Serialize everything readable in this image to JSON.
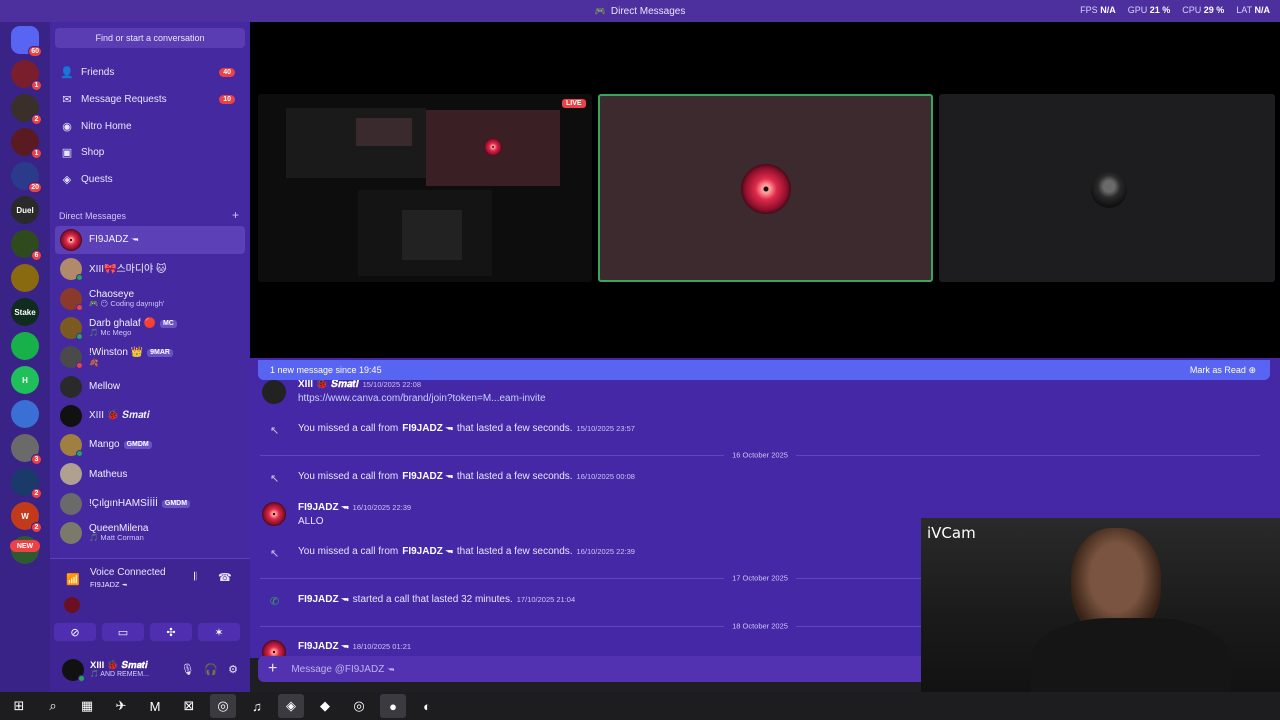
{
  "window": {
    "title": "Direct Messages",
    "stats": [
      {
        "label": "FPS",
        "value": "N/A"
      },
      {
        "label": "GPU",
        "value": "21 %"
      },
      {
        "label": "CPU",
        "value": "29 %"
      },
      {
        "label": "LAT",
        "value": "N/A"
      }
    ]
  },
  "servers": [
    {
      "name": "discord-home-icon",
      "badge": "60",
      "color": "#5865f2"
    },
    {
      "name": "server-1",
      "badge": "1",
      "color": "#7a1e2e"
    },
    {
      "name": "server-2",
      "badge": "2",
      "color": "#3b2f2a"
    },
    {
      "name": "server-3",
      "badge": "1",
      "color": "#5a1a22"
    },
    {
      "name": "server-4",
      "badge": "20",
      "color": "#2b3a8a"
    },
    {
      "name": "server-duel",
      "label": "Duel",
      "badge": "",
      "color": "#2a2a2a"
    },
    {
      "name": "server-ck",
      "badge": "6",
      "color": "#2f4a1d"
    },
    {
      "name": "server-gold",
      "badge": "",
      "color": "#8a6a10"
    },
    {
      "name": "server-stake",
      "label": "Stake",
      "badge": "",
      "color": "#0f2c1e"
    },
    {
      "name": "server-green",
      "badge": "",
      "color": "#18b04a"
    },
    {
      "name": "server-h",
      "label": "H",
      "badge": "",
      "color": "#1fbf5a"
    },
    {
      "name": "server-anime",
      "badge": "",
      "color": "#3a6fd6"
    },
    {
      "name": "server-8",
      "badge": "3",
      "color": "#6a6a6a"
    },
    {
      "name": "server-9",
      "badge": "2",
      "color": "#1a3a6a"
    },
    {
      "name": "server-w",
      "label": "W",
      "badge": "2",
      "color": "#c23a1a"
    },
    {
      "name": "server-11",
      "badge": "",
      "color": "#2f5a2f"
    }
  ],
  "new_label": "NEW",
  "dm_panel": {
    "search_label": "Find or start a conversation",
    "nav": [
      {
        "label": "Friends",
        "icon": "friends-icon",
        "count": "40"
      },
      {
        "label": "Message Requests",
        "icon": "mail-icon",
        "count": "10"
      },
      {
        "label": "Nitro Home",
        "icon": "nitro-icon",
        "count": ""
      },
      {
        "label": "Shop",
        "icon": "shop-icon",
        "count": ""
      },
      {
        "label": "Quests",
        "icon": "quests-icon",
        "count": ""
      }
    ],
    "dm_header": "Direct Messages",
    "add_dm": "+",
    "dms": [
      {
        "name": "FI9JADZ 🖚",
        "sub": "",
        "tag": "",
        "color": "#6b1020",
        "status": ""
      },
      {
        "name": "XIII🎀스마디야 🐱",
        "sub": "",
        "tag": "",
        "color": "#b08a6a",
        "status": "#23a55a"
      },
      {
        "name": "Chaoseye",
        "sub": "🎮 😶 Coding daynıgh'",
        "tag": "",
        "color": "#8a3a2a",
        "status": "#ed4245"
      },
      {
        "name": "Darb ghalaf 🔴",
        "sub": "🎵 Mc Mego",
        "tag": "MC",
        "color": "#7a5a20",
        "status": "#23a55a"
      },
      {
        "name": "!Winston 👑",
        "sub": "🍂",
        "tag": "9MAR",
        "color": "#4a4a4a",
        "status": "#ed4245"
      },
      {
        "name": "Mellow",
        "sub": "",
        "tag": "",
        "color": "#2a2a2a",
        "status": ""
      },
      {
        "name": "XIII 🐞 𝑺𝒎𝒂𝒕𝒊",
        "sub": "",
        "tag": "",
        "color": "#111",
        "status": ""
      },
      {
        "name": "Mango",
        "sub": "",
        "tag": "GMDM",
        "color": "#a08040",
        "status": "#23a55a"
      },
      {
        "name": "Matheus",
        "sub": "",
        "tag": "",
        "color": "#b0a090",
        "status": ""
      },
      {
        "name": "!ÇılgınHAMSİİİİ",
        "sub": "",
        "tag": "GMDM",
        "color": "#6a6a6a",
        "status": ""
      },
      {
        "name": "QueenMilena",
        "sub": "🎵 Matt Corman",
        "tag": "",
        "color": "#7a7a6a",
        "status": ""
      }
    ]
  },
  "voice": {
    "title": "Voice Connected",
    "channel": "FI9JADZ 🖚"
  },
  "user": {
    "name": "XIII 🐞 𝑺𝒎𝒂𝒕𝒊",
    "status": "🎵 AND REMEM..."
  },
  "stage": {
    "live_label": "LIVE"
  },
  "chat": {
    "new_messages": "1 new message since 19:45",
    "mark_as_read": "Mark as Read",
    "messages": [
      {
        "author": "XIII 🐞 𝑺𝒎𝒂𝒕𝒊",
        "time": "15/10/2025 22:08",
        "text": "https://www.canva.com/brand/join?token=M...eam-invite"
      },
      {
        "sys_pre": "You missed a call from",
        "author": "FI9JADZ 🖚",
        "sys_post": "that lasted a few seconds.",
        "time": "15/10/2025 23:57"
      },
      {
        "divider": "16 October 2025"
      },
      {
        "sys_pre": "You missed a call from",
        "author": "FI9JADZ 🖚",
        "sys_post": "that lasted a few seconds.",
        "time": "16/10/2025 00:08"
      },
      {
        "author": "FI9JADZ 🖚",
        "time": "16/10/2025 22:39",
        "text": "ALLO"
      },
      {
        "sys_pre": "You missed a call from",
        "author": "FI9JADZ 🖚",
        "sys_post": "that lasted a few seconds.",
        "time": "16/10/2025 22:39"
      },
      {
        "divider": "17 October 2025"
      },
      {
        "author": "FI9JADZ 🖚",
        "sys_post": "started a call that lasted 32 minutes.",
        "time": "17/10/2025 21:04"
      },
      {
        "divider": "18 October 2025"
      },
      {
        "author": "FI9JADZ 🖚",
        "time": "18/10/2025 01:21"
      }
    ],
    "input_placeholder": "Message @FI9JADZ 🖚"
  },
  "webcam": {
    "label": "iVCam"
  },
  "taskbar": [
    "windows-start-icon",
    "search-icon",
    "calculator-icon",
    "telegram-icon",
    "malwarebytes-icon",
    "xbox-icon",
    "chrome-icon",
    "spotify-icon",
    "discord-icon",
    "steam-icon",
    "chrome-profile-icon",
    "obs-icon",
    "app-icon"
  ]
}
